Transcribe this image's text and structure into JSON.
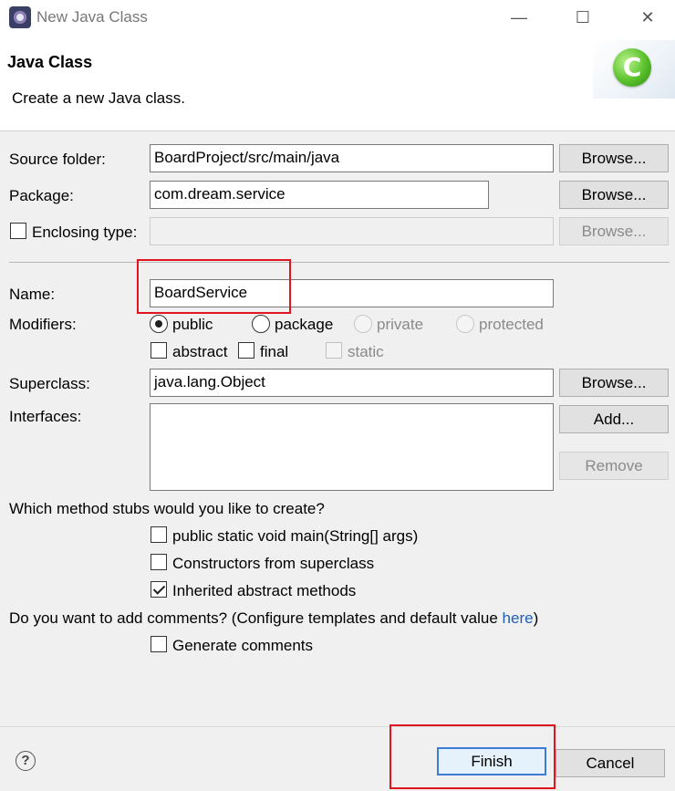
{
  "window": {
    "title": "New Java Class",
    "controls": {
      "minimize": "—",
      "maximize": "☐",
      "close": "✕"
    }
  },
  "header": {
    "title": "Java Class",
    "description": "Create a new Java class.",
    "icon": "class-c-icon",
    "icon_glyph": "C"
  },
  "source_folder": {
    "label": "Source folder:",
    "value": "BoardProject/src/main/java",
    "browse": "Browse..."
  },
  "package": {
    "label": "Package:",
    "value": "com.dream.service",
    "browse": "Browse..."
  },
  "enclosing_type": {
    "label": "Enclosing type:",
    "checked": false,
    "value": "",
    "browse": "Browse..."
  },
  "name": {
    "label": "Name:",
    "value": "BoardService"
  },
  "modifiers": {
    "label": "Modifiers:",
    "access": [
      {
        "label": "public",
        "selected": true,
        "enabled": true
      },
      {
        "label": "package",
        "selected": false,
        "enabled": true
      },
      {
        "label": "private",
        "selected": false,
        "enabled": false
      },
      {
        "label": "protected",
        "selected": false,
        "enabled": false
      }
    ],
    "flags": [
      {
        "label": "abstract",
        "checked": false,
        "enabled": true
      },
      {
        "label": "final",
        "checked": false,
        "enabled": true
      },
      {
        "label": "static",
        "checked": false,
        "enabled": false
      }
    ]
  },
  "superclass": {
    "label": "Superclass:",
    "value": "java.lang.Object",
    "browse": "Browse..."
  },
  "interfaces": {
    "label": "Interfaces:",
    "add": "Add...",
    "remove": "Remove"
  },
  "stubs": {
    "question": "Which method stubs would you like to create?",
    "options": [
      {
        "label": "public static void main(String[] args)",
        "checked": false
      },
      {
        "label": "Constructors from superclass",
        "checked": false
      },
      {
        "label": "Inherited abstract methods",
        "checked": true
      }
    ]
  },
  "comments": {
    "question_prefix": "Do you want to add comments? (Configure templates and default value ",
    "link": "here",
    "question_suffix": ")",
    "option": {
      "label": "Generate comments",
      "checked": false
    }
  },
  "footer": {
    "help_glyph": "?",
    "finish": "Finish",
    "cancel": "Cancel"
  },
  "colors": {
    "highlight": "#e0141e",
    "link": "#1f5fb8",
    "default_button_border": "#3d7bd6"
  }
}
